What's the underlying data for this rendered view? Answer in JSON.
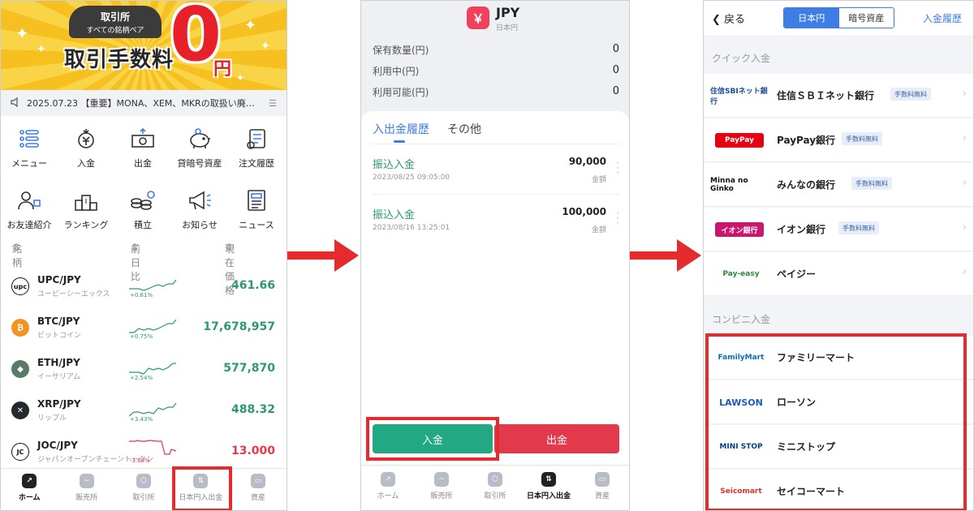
{
  "panel1": {
    "banner": {
      "pill_line1": "取引所",
      "pill_line2": "すべての銘柄ペア",
      "fee_text": "取引手数料",
      "zero": "0",
      "yen": "円"
    },
    "news": "2025.07.23 【重要】MONA、XEM、MKRの取扱い廃…",
    "menu_rows": [
      [
        {
          "label": "メニュー",
          "icon": "menu-list-icon"
        },
        {
          "label": "入金",
          "icon": "deposit-yen-icon"
        },
        {
          "label": "出金",
          "icon": "withdraw-cash-icon"
        },
        {
          "label": "貸暗号資産",
          "icon": "piggy-bank-icon"
        },
        {
          "label": "注文履歴",
          "icon": "order-history-icon"
        }
      ],
      [
        {
          "label": "お友達紹介",
          "icon": "invite-friends-icon"
        },
        {
          "label": "ランキング",
          "icon": "podium-ranking-icon"
        },
        {
          "label": "積立",
          "icon": "coin-stack-icon"
        },
        {
          "label": "お知らせ",
          "icon": "megaphone-icon"
        },
        {
          "label": "ニュース",
          "icon": "newspaper-icon"
        }
      ]
    ],
    "list_header": {
      "col1": "銘柄",
      "col2": "前日比",
      "col3": "現在価格"
    },
    "coins": [
      {
        "pair": "UPC/JPY",
        "name": "ユーピーシーエックス",
        "change": "+0.61%",
        "price": "461.66",
        "logo": "upc",
        "logo_color": "#ffffff",
        "price_color": "#2b9a6e",
        "trend": "up"
      },
      {
        "pair": "BTC/JPY",
        "name": "ビットコイン",
        "change": "+0.75%",
        "price": "17,678,957",
        "logo": "₿",
        "logo_color": "#f39322",
        "price_color": "#2b9a6e",
        "trend": "up"
      },
      {
        "pair": "ETH/JPY",
        "name": "イーサリアム",
        "change": "+2.54%",
        "price": "577,870",
        "logo": "◆",
        "logo_color": "#5a7a68",
        "price_color": "#2b9a6e",
        "trend": "up"
      },
      {
        "pair": "XRP/JPY",
        "name": "リップル",
        "change": "+3.43%",
        "price": "488.32",
        "logo": "✕",
        "logo_color": "#23292f",
        "price_color": "#2b9a6e",
        "trend": "up"
      },
      {
        "pair": "JOC/JPY",
        "name": "ジャパンオープンチェーントークン",
        "change": "-3.68%",
        "price": "13.000",
        "logo": "JC",
        "logo_color": "#ffffff",
        "price_color": "#e2394d",
        "trend": "down"
      }
    ],
    "tabs": [
      {
        "label": "ホーム",
        "icon": "home-chart-icon",
        "active": true
      },
      {
        "label": "販売所",
        "icon": "wave-icon",
        "active": false
      },
      {
        "label": "取引所",
        "icon": "coin-exchange-icon",
        "active": false
      },
      {
        "label": "日本円入出金",
        "icon": "transfer-arrows-icon",
        "active": false
      },
      {
        "label": "資産",
        "icon": "wallet-icon",
        "active": false
      }
    ]
  },
  "panel2": {
    "currency": "JPY",
    "currency_sub": "日本円",
    "icon_glyph": "￥",
    "balances": [
      {
        "label": "保有数量(円)",
        "value": "0"
      },
      {
        "label": "利用中(円)",
        "value": "0"
      },
      {
        "label": "利用可能(円)",
        "value": "0"
      }
    ],
    "tab_active": "入出金履歴",
    "tab_other": "その他",
    "transactions": [
      {
        "type": "振込入金",
        "date": "2023/08/25 09:05:00",
        "amount": "90,000",
        "amount_label": "金額"
      },
      {
        "type": "振込入金",
        "date": "2023/08/16 13:25:01",
        "amount": "100,000",
        "amount_label": "金額"
      }
    ],
    "deposit_label": "入金",
    "withdraw_label": "出金",
    "colors": {
      "deposit": "#22a883",
      "withdraw": "#e2394d"
    },
    "tabs": [
      {
        "label": "ホーム",
        "icon": "home-chart-icon",
        "active": false
      },
      {
        "label": "販売所",
        "icon": "wave-icon",
        "active": false
      },
      {
        "label": "取引所",
        "icon": "coin-exchange-icon",
        "active": false
      },
      {
        "label": "日本円入出金",
        "icon": "transfer-arrows-icon",
        "active": true
      },
      {
        "label": "資産",
        "icon": "wallet-icon",
        "active": false
      }
    ]
  },
  "panel3": {
    "back_label": "戻る",
    "seg_on": "日本円",
    "seg_off": "暗号資産",
    "history_label": "入金履歴",
    "quick_title": "クイック入金",
    "banks": [
      {
        "logo": "住信SBIネット銀行",
        "name": "住信ＳＢＩネット銀行",
        "badge": "手数料無料"
      },
      {
        "logo": "PayPay",
        "name": "PayPay銀行",
        "badge": "手数料無料"
      },
      {
        "logo": "Minna no Ginko",
        "name": "みんなの銀行",
        "badge": "手数料無料"
      },
      {
        "logo": "イオン銀行",
        "name": "イオン銀行",
        "badge": "手数料無料"
      },
      {
        "logo": "Pay-easy",
        "name": "ペイジー",
        "badge": ""
      }
    ],
    "conv_title": "コンビニ入金",
    "stores": [
      {
        "logo": "FamilyMart",
        "name": "ファミリーマート"
      },
      {
        "logo": "LAWSON",
        "name": "ローソン"
      },
      {
        "logo": "MINI STOP",
        "name": "ミニストップ"
      },
      {
        "logo": "Seicomart",
        "name": "セイコーマート"
      }
    ]
  },
  "colors": {
    "highlight": "#e52b2b",
    "accent": "#3f7de6",
    "up": "#2b9a6e",
    "down": "#e2394d"
  }
}
